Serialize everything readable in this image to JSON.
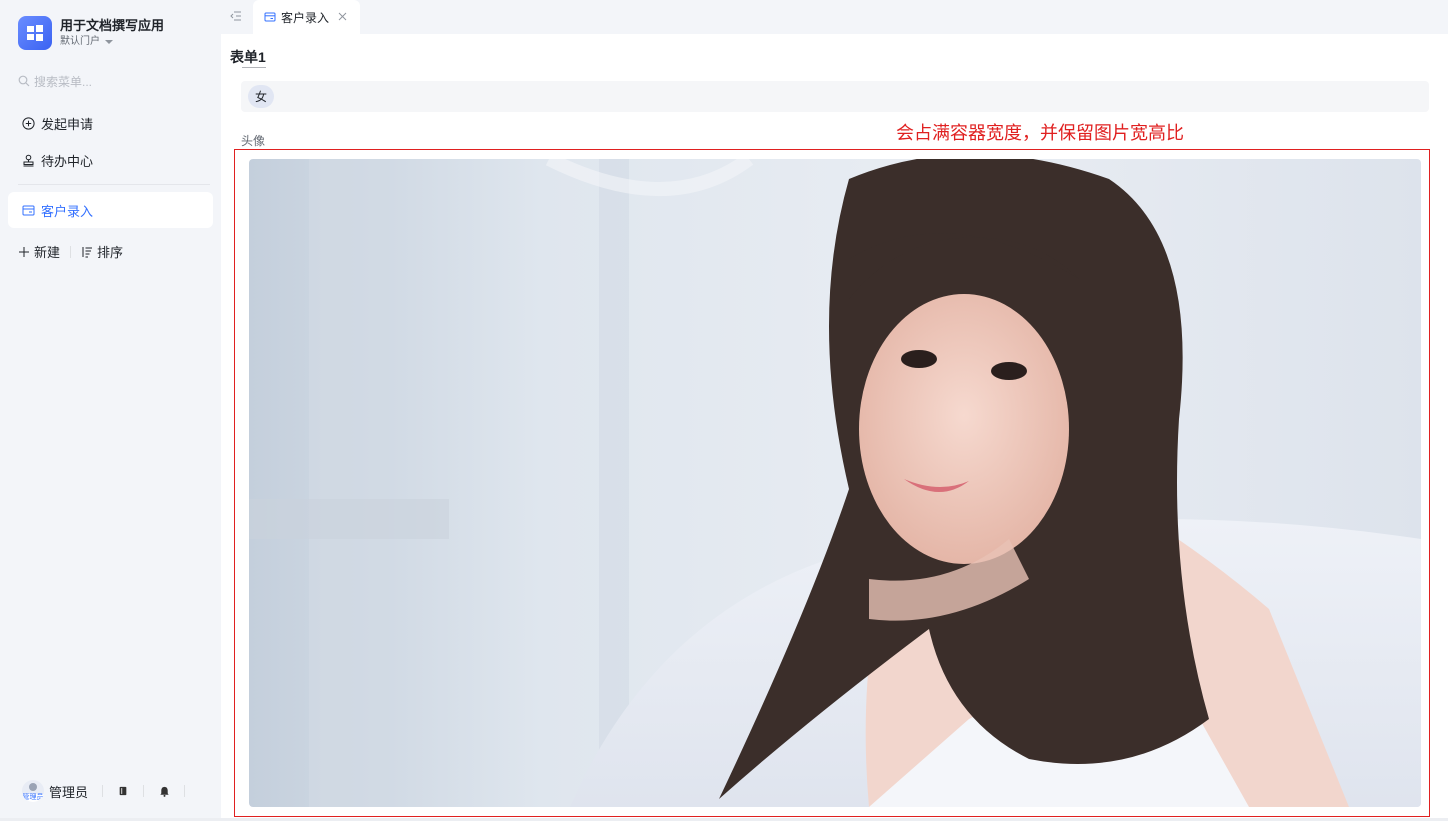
{
  "app": {
    "title": "用于文档撰写应用",
    "portal": "默认门户"
  },
  "search": {
    "placeholder": "搜索菜单..."
  },
  "menu": {
    "items": [
      {
        "label": "发起申请",
        "icon": "plus-circle-icon"
      },
      {
        "label": "待办中心",
        "icon": "stamp-icon"
      },
      {
        "label": "客户录入",
        "icon": "form-icon",
        "active": true
      }
    ],
    "actions": {
      "new_label": "新建",
      "sort_label": "排序"
    }
  },
  "user": {
    "name": "管理员",
    "avatar_caption": "管理员"
  },
  "tabs": [
    {
      "label": "客户录入",
      "icon": "form-icon",
      "active": true
    }
  ],
  "form": {
    "title": "表单1",
    "gender_field": {
      "value": "女"
    },
    "avatar_field": {
      "label": "头像"
    }
  },
  "annotation": {
    "text": "会占满容器宽度，并保留图片宽高比",
    "color": "#e02020"
  },
  "colors": {
    "accent": "#3370ff",
    "sidebar_bg": "#f3f5f9",
    "annotation_red": "#e02020"
  }
}
